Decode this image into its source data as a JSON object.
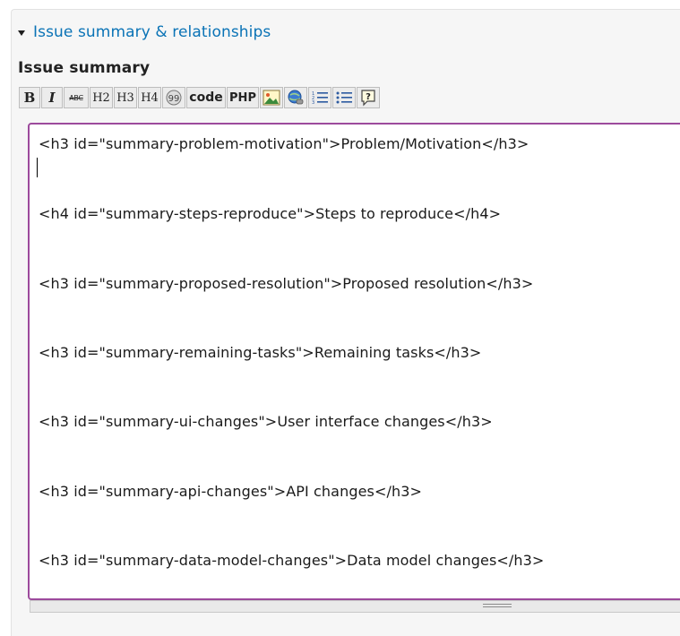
{
  "fieldset": {
    "legend": "Issue summary & relationships"
  },
  "field": {
    "label": "Issue summary"
  },
  "toolbar": {
    "buttons": [
      {
        "label": "B",
        "icon": "bold-icon"
      },
      {
        "label": "I",
        "icon": "italic-icon"
      },
      {
        "label": "ABC",
        "icon": "strikethrough-icon"
      },
      {
        "label": "H2",
        "icon": "heading-2-icon"
      },
      {
        "label": "H3",
        "icon": "heading-3-icon"
      },
      {
        "label": "H4",
        "icon": "heading-4-icon"
      },
      {
        "label": "",
        "icon": "quote-icon"
      },
      {
        "label": "code",
        "icon": "code-icon"
      },
      {
        "label": "PHP",
        "icon": "php-icon"
      },
      {
        "label": "",
        "icon": "image-icon"
      },
      {
        "label": "",
        "icon": "link-icon"
      },
      {
        "label": "",
        "icon": "ordered-list-icon"
      },
      {
        "label": "",
        "icon": "unordered-list-icon"
      },
      {
        "label": "",
        "icon": "help-icon"
      }
    ]
  },
  "editor": {
    "lines": [
      "<h3 id=\"summary-problem-motivation\">Problem/Motivation</h3>",
      "<h4 id=\"summary-steps-reproduce\">Steps to reproduce</h4>",
      "<h3 id=\"summary-proposed-resolution\">Proposed resolution</h3>",
      "<h3 id=\"summary-remaining-tasks\">Remaining tasks</h3>",
      "<h3 id=\"summary-ui-changes\">User interface changes</h3>",
      "<h3 id=\"summary-api-changes\">API changes</h3>",
      "<h3 id=\"summary-data-model-changes\">Data model changes</h3>"
    ]
  },
  "colors": {
    "link": "#0a73b6",
    "focus_border": "#9c4a9c",
    "panel_background": "#f6f6f6"
  }
}
